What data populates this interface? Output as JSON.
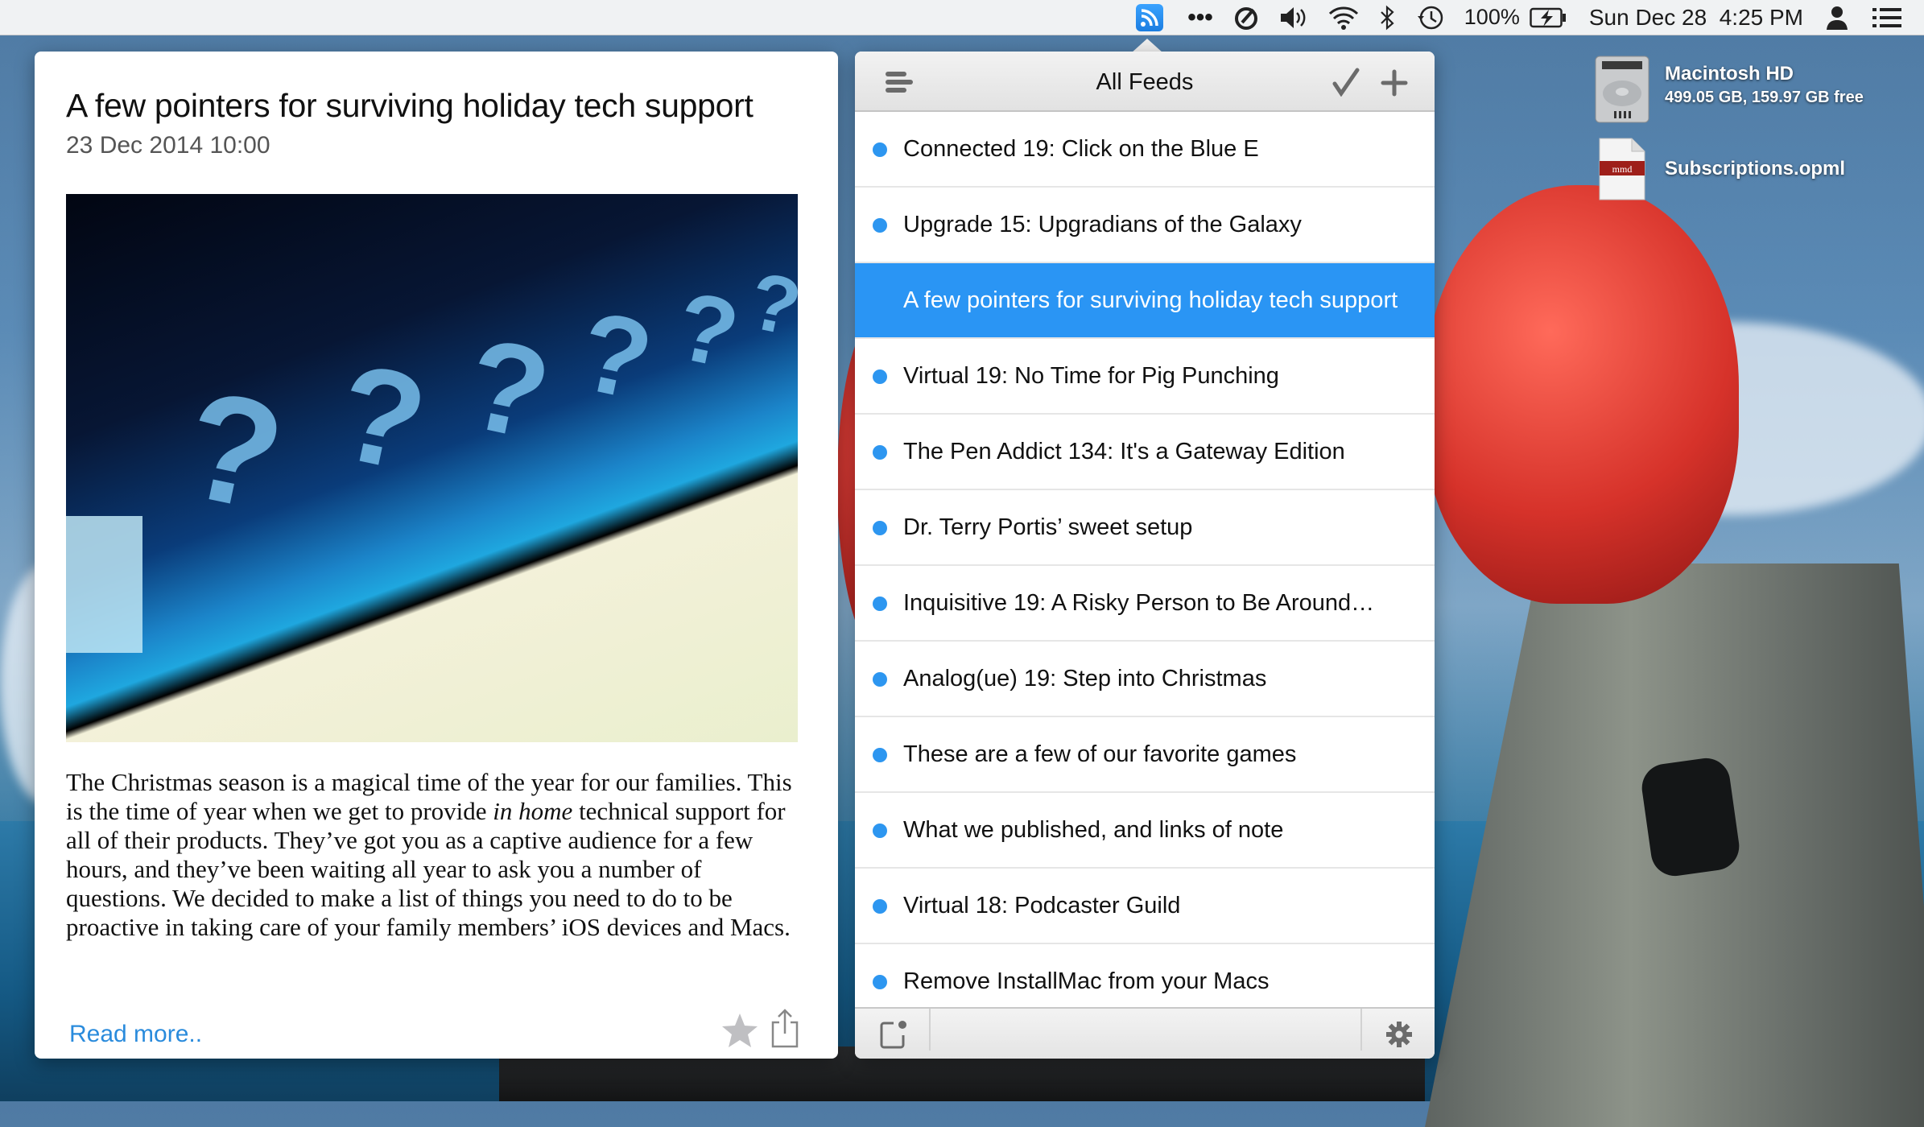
{
  "menubar": {
    "rss_icon": "rss-icon",
    "items": [
      "more-icon",
      "speed-icon",
      "volume-icon",
      "wifi-icon",
      "bluetooth-icon",
      "time-machine-icon"
    ],
    "battery_percent": "100%",
    "battery_icon": "battery-charging-icon",
    "datetime": "Sun Dec 28  4:25 PM",
    "user_icon": "user-icon",
    "notification_icon": "list-icon"
  },
  "article": {
    "title": "A few pointers for surviving holiday tech support",
    "date": "23 Dec 2014 10:00",
    "body_part1": "The Christmas season is a magical time of the year for our families. This is the time of year when we get to provide ",
    "body_emphasis": "in home",
    "body_part2": " technical support for all of their products. They’ve got you as a captive audience for a few hours, and they’ve been waiting all year to ask you a number of questions. We decided to make a list of things you need to do to be proactive in taking care of your family members’ iOS devices and Macs.",
    "read_more": "Read more..",
    "star_icon": "star-icon",
    "share_icon": "share-icon"
  },
  "feeds": {
    "title": "All Feeds",
    "selected_index": 2,
    "items": [
      {
        "title": "Connected 19: Click on the Blue E",
        "unread": true
      },
      {
        "title": "Upgrade 15: Upgradians of the Galaxy",
        "unread": true
      },
      {
        "title": "A few pointers for surviving holiday tech support",
        "unread": false
      },
      {
        "title": "Virtual 19: No Time for Pig Punching",
        "unread": true
      },
      {
        "title": "The Pen Addict 134: It's a Gateway Edition",
        "unread": true
      },
      {
        "title": "Dr. Terry Portis’ sweet setup",
        "unread": true
      },
      {
        "title": "Inquisitive 19: A Risky Person to Be Around…",
        "unread": true
      },
      {
        "title": "Analog(ue) 19: Step into Christmas",
        "unread": true
      },
      {
        "title": "These are a few of our favorite games",
        "unread": true
      },
      {
        "title": "What we published, and links of note",
        "unread": true
      },
      {
        "title": "Virtual 18: Podcaster Guild",
        "unread": true
      },
      {
        "title": "Remove InstallMac from your Macs",
        "unread": true
      }
    ]
  },
  "desktop": {
    "items": [
      {
        "name": "Macintosh HD",
        "subtitle": "499.05 GB, 159.97 GB free",
        "icon": "hard-drive-icon"
      },
      {
        "name": "Subscriptions.opml",
        "icon": "document-icon",
        "badge": "mmd"
      }
    ]
  },
  "colors": {
    "accent": "#2a95f4",
    "unread_dot": "#2d96f0",
    "link": "#2a8bdc"
  }
}
